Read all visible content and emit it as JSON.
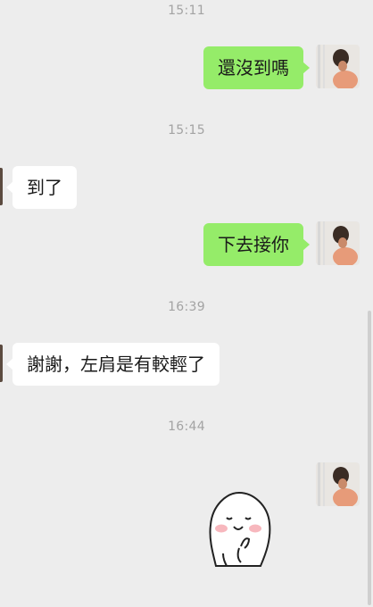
{
  "chat": {
    "messages": [
      {
        "kind": "time",
        "text": "15:11"
      },
      {
        "kind": "text",
        "side": "outgoing",
        "text": "還沒到嗎"
      },
      {
        "kind": "time",
        "text": "15:15"
      },
      {
        "kind": "text",
        "side": "incoming",
        "text": "到了"
      },
      {
        "kind": "text",
        "side": "outgoing",
        "text": "下去接你"
      },
      {
        "kind": "time",
        "text": "16:39"
      },
      {
        "kind": "text",
        "side": "incoming",
        "text": "謝謝，左肩是有較輕了"
      },
      {
        "kind": "time",
        "text": "16:44"
      },
      {
        "kind": "sticker",
        "side": "outgoing",
        "sticker_name": "smiling-blob-sticker"
      }
    ]
  },
  "colors": {
    "background": "#ededed",
    "outgoing_bubble": "#95ec69",
    "incoming_bubble": "#ffffff",
    "timestamp_text": "#a3a3a3"
  },
  "icons": {
    "self_avatar": "profile-photo",
    "sticker": "smiling-blob-sticker"
  }
}
